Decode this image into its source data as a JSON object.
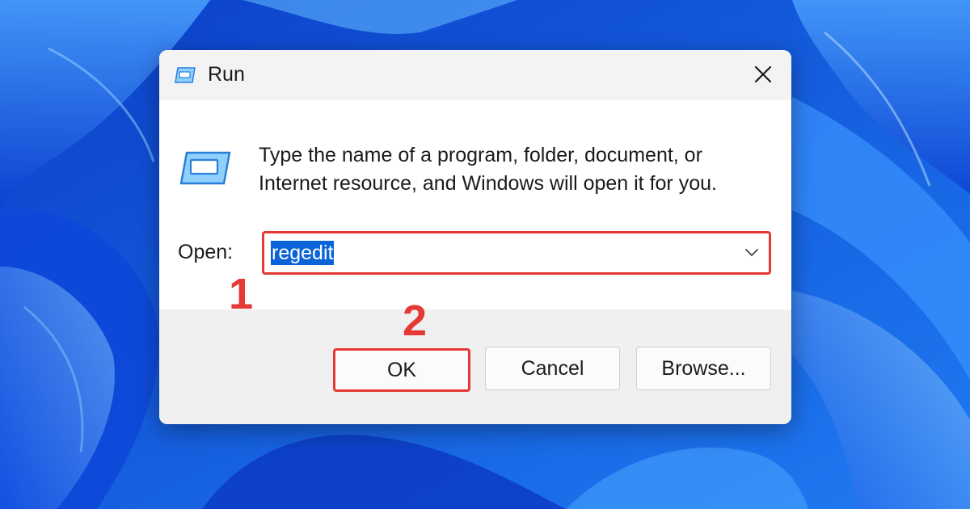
{
  "dialog": {
    "title": "Run",
    "description": "Type the name of a program, folder, document, or Internet resource, and Windows will open it for you.",
    "open_label": "Open:",
    "open_value": "regedit",
    "buttons": {
      "ok": "OK",
      "cancel": "Cancel",
      "browse": "Browse..."
    }
  },
  "annotations": {
    "step1": "1",
    "step2": "2"
  },
  "icons": {
    "title": "run-icon",
    "body": "run-icon",
    "close": "close-icon",
    "dropdown": "chevron-down-icon"
  },
  "colors": {
    "highlight": "#e53935",
    "selection": "#0a64d8",
    "wallpaper": "#1a5fe0"
  }
}
